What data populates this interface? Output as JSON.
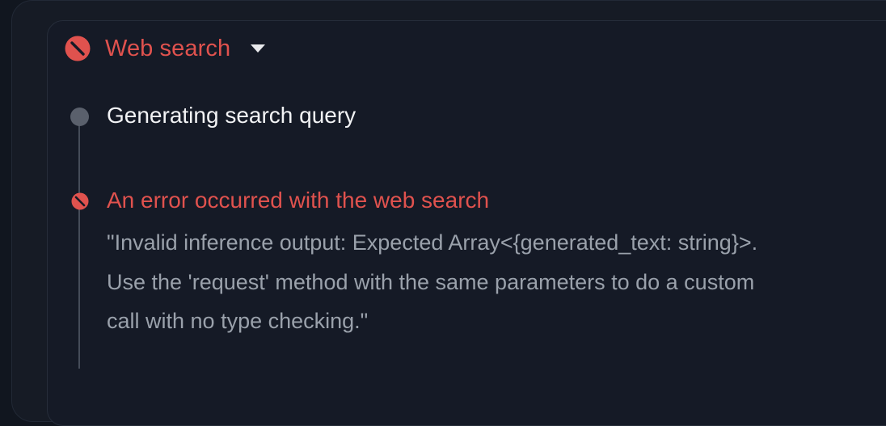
{
  "panel": {
    "title": "Web search",
    "status_color": "#e0524e",
    "icons": {
      "status": "blocked-icon",
      "toggle": "triangle-down-icon"
    }
  },
  "steps": [
    {
      "status": "done",
      "label": "Generating search query",
      "icon": "dot-icon"
    },
    {
      "status": "error",
      "label": "An error occurred with the web search",
      "icon": "blocked-icon",
      "message": "\"Invalid inference output: Expected Array<{generated_text: string}>.\nUse the 'request' method with the same parameters to do a custom\ncall with no type checking.\""
    }
  ]
}
